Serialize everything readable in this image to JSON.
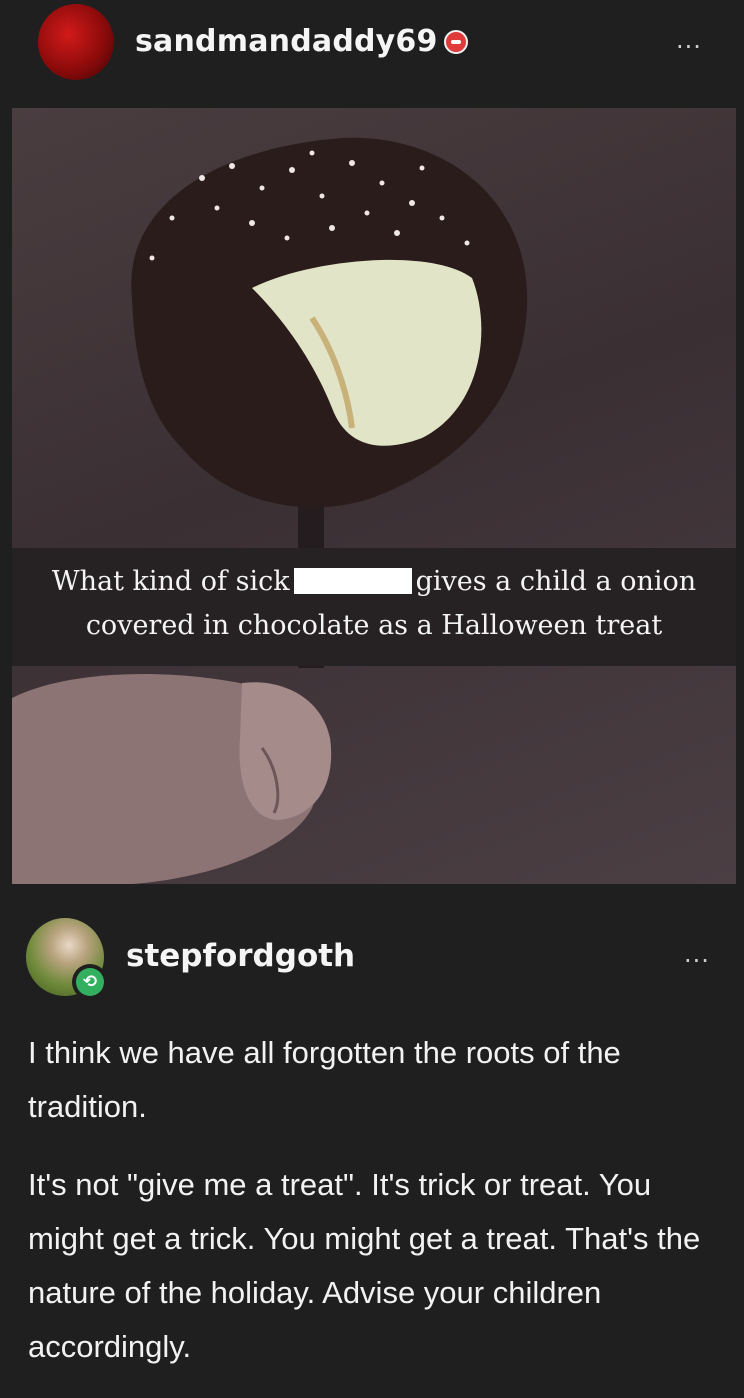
{
  "post": {
    "username": "sandmandaddy69",
    "more_label": "...",
    "image": {
      "caption_before": "What kind of sick",
      "caption_after": "gives a child a onion",
      "caption_line2": "covered in chocolate as a Halloween treat"
    }
  },
  "reblog": {
    "username": "stepfordgoth",
    "more_label": "...",
    "paragraph1": "I think we have all forgotten the roots of the tradition.",
    "paragraph2": "It's not \"give me a treat\". It's trick or treat. You might get a trick. You might get a treat. That's the nature of the holiday. Advise your children accordingly."
  },
  "colors": {
    "background": "#1f1f1f",
    "reblog_badge": "#32b05f",
    "avatar_red": "#b01313"
  },
  "icons": [
    "avatar",
    "verified-badge-icon",
    "more-icon",
    "reblog-icon"
  ]
}
